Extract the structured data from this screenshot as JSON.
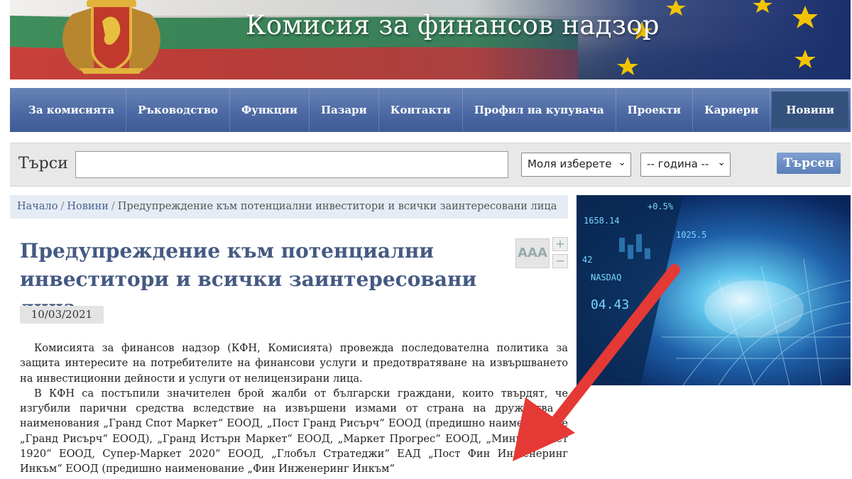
{
  "banner": {
    "title": "Комисия за финансов надзор"
  },
  "nav": {
    "items": [
      {
        "label": "За комисията"
      },
      {
        "label": "Ръководство"
      },
      {
        "label": "Функции"
      },
      {
        "label": "Пазари"
      },
      {
        "label": "Контакти"
      },
      {
        "label": "Профил на купувача"
      },
      {
        "label": "Проекти"
      },
      {
        "label": "Кариери"
      },
      {
        "label": "Новини",
        "active": true
      }
    ]
  },
  "search": {
    "label": "Търси",
    "input_value": "",
    "category_select": "Моля изберете",
    "year_select": "-- година --",
    "button": "Търсен"
  },
  "breadcrumb": {
    "home": "Начало",
    "section": "Новини",
    "current": "Предупреждение към потенциални инвеститори и всички заинтересовани лица"
  },
  "article": {
    "title": "Предупреждение към потенциални инвеститори и всички заинтересовани лица",
    "date": "10/03/2021",
    "font_tool_label": "AAA",
    "font_plus": "+",
    "font_minus": "−",
    "paragraphs": [
      "Комисията за финансов надзор (КФН, Комисията) провежда последователна политика за защита интересите на потребителите на финансови услуги и предотвратяване на извършването на инвестиционни дейности и услуги от нелицензирани лица.",
      "В КФН са постъпили значителен брой жалби от български граждани, които твърдят, че изгубили парични средства вследствие на извършени измами от страна на дружества с наименования „Гранд Спот Маркет“ ЕООД, „Пост Гранд Рисърч“ ЕООД (предишно наименование „Гранд Рисърч“ ЕООД), „Гранд Истърн Маркет“ ЕООД, „Маркет Прогрес“ ЕООД, „Мини-Маркет 1920“ ЕООД, Супер-Маркет 2020“ ЕООД, „Глобъл Стратеджи“ ЕАД „Пост Фин Инженеринг Инкъм“ ЕООД (предишно наименование „Фин Инженеринг Инкъм“"
    ]
  },
  "hero": {
    "tickers": [
      "1658.14",
      "1025.5",
      "+0.5%",
      "NASDAQ",
      "04.43",
      "42"
    ]
  },
  "colors": {
    "nav_bg": "#4b68a3",
    "nav_active": "#34507d",
    "title_color": "#455a82",
    "arrow": "#e53935"
  }
}
